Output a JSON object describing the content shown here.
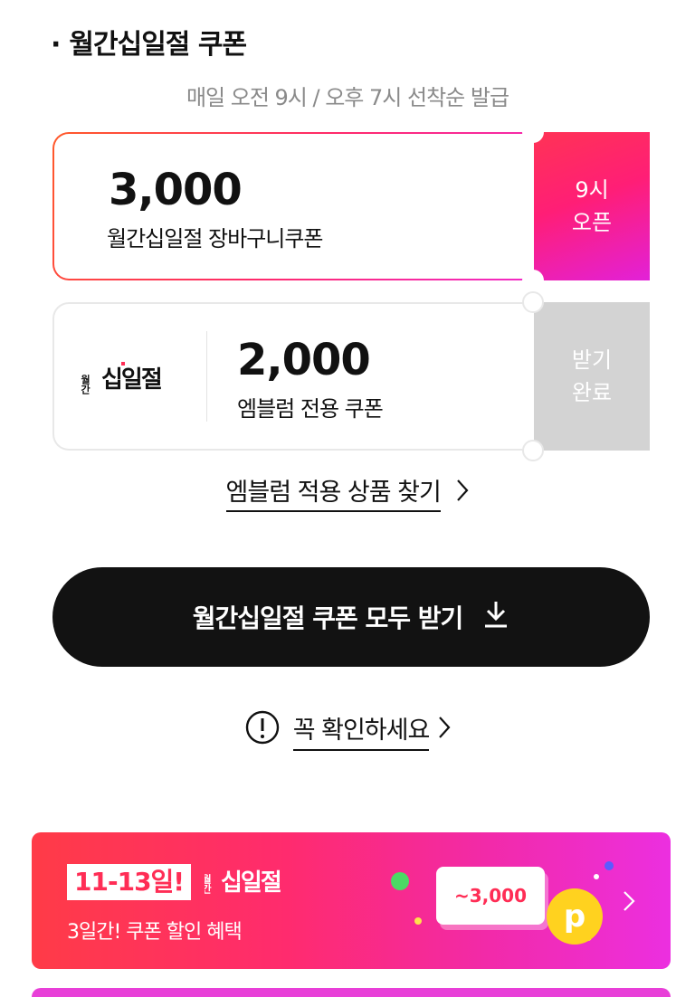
{
  "header": {
    "bullet": "·",
    "title": "월간십일절 쿠폰",
    "subtitle": "매일 오전 9시 / 오후 7시 선착순 발급"
  },
  "coupons": [
    {
      "amount": "3,000",
      "name": "월간십일절 장바구니쿠폰",
      "button_line1": "9시",
      "button_line2": "오픈"
    },
    {
      "amount": "2,000",
      "name": "엠블럼 전용 쿠폰",
      "button_line1": "받기",
      "button_line2": "완료",
      "logo_small": "월간",
      "logo_big": "십일절"
    }
  ],
  "emblem_link": {
    "label": "엠블럼 적용 상품 찾기"
  },
  "download_all": {
    "label": "월간십일절 쿠폰 모두 받기"
  },
  "notice_link": {
    "label": "꼭 확인하세요"
  },
  "banner": {
    "tag": "11-13일!",
    "logo_small": "월간",
    "logo_big": "십일절",
    "subtitle": "3일간! 쿠폰 할인 혜택",
    "coupon_value": "~3,000",
    "coin_letter": "p"
  },
  "colors": {
    "accent_pink": "#ff2d55",
    "button_dark": "#121212",
    "disabled_gray": "#d3d3d3"
  }
}
